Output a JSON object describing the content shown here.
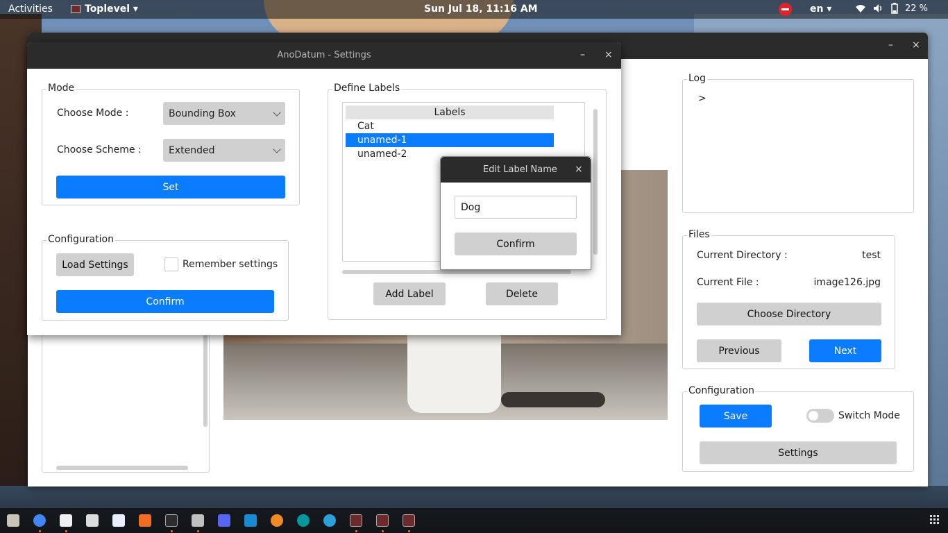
{
  "topbar": {
    "activities": "Activities",
    "app_name": "Toplevel ▾",
    "clock": "Sun Jul 18, 11:16 AM",
    "lang": "en ▾",
    "battery": "22 %",
    "icons": [
      "wifi-icon",
      "volume-icon",
      "battery-icon"
    ]
  },
  "main_window": {
    "minimize": "–",
    "close": "×",
    "log": {
      "title": "Log",
      "prompt": ">"
    },
    "files": {
      "title": "Files",
      "current_directory_label": "Current Directory :",
      "current_directory_value": "test",
      "current_file_label": "Current File :",
      "current_file_value": "image126.jpg",
      "choose_directory": "Choose Directory",
      "previous": "Previous",
      "next": "Next"
    },
    "configuration": {
      "title": "Configuration",
      "save": "Save",
      "switch_mode": "Switch Mode",
      "settings": "Settings"
    }
  },
  "settings_window": {
    "title": "AnoDatum - Settings",
    "minimize": "–",
    "close": "×",
    "mode": {
      "title": "Mode",
      "choose_mode_label": "Choose Mode :",
      "choose_mode_value": "Bounding Box",
      "choose_scheme_label": "Choose Scheme :",
      "choose_scheme_value": "Extended",
      "set": "Set"
    },
    "configuration": {
      "title": "Configuration",
      "load_settings": "Load Settings",
      "remember_settings": "Remember settings",
      "remember_checked": false,
      "confirm": "Confirm"
    },
    "define_labels": {
      "title": "Define Labels",
      "header": "Labels",
      "items": [
        "Cat",
        "unamed-1",
        "unamed-2"
      ],
      "selected_index": 1,
      "add_label": "Add Label",
      "delete": "Delete"
    }
  },
  "edit_dialog": {
    "title": "Edit Label Name",
    "minimize": "–",
    "close": "×",
    "input_value": "Dog",
    "confirm": "Confirm"
  },
  "colors": {
    "accent": "#0a7cff",
    "button_gray": "#d0d0d0",
    "titlebar": "#2b2b2b"
  }
}
